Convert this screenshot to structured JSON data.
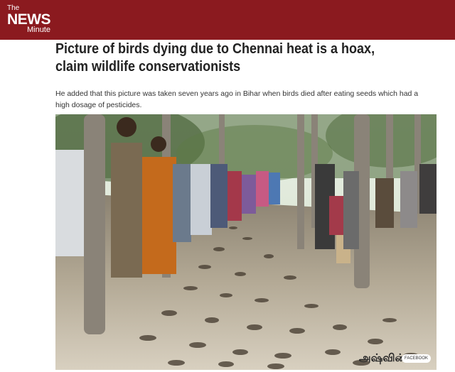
{
  "brand": {
    "the": "The",
    "news": "NEWS",
    "minute": "Minute"
  },
  "article": {
    "headline": "Picture of birds dying due to Chennai heat is a hoax, claim wildlife conservationists",
    "summary": "He added that this picture was taken seven years ago in Bihar when birds died after eating seeds which had a high dosage of pesticides."
  },
  "photo": {
    "watermark": "அஷ்வின்",
    "source_badge": "FACEBOOK"
  },
  "colors": {
    "header_bg": "#8b1a1f",
    "brand_text": "#ffffff",
    "headline_text": "#222222"
  }
}
